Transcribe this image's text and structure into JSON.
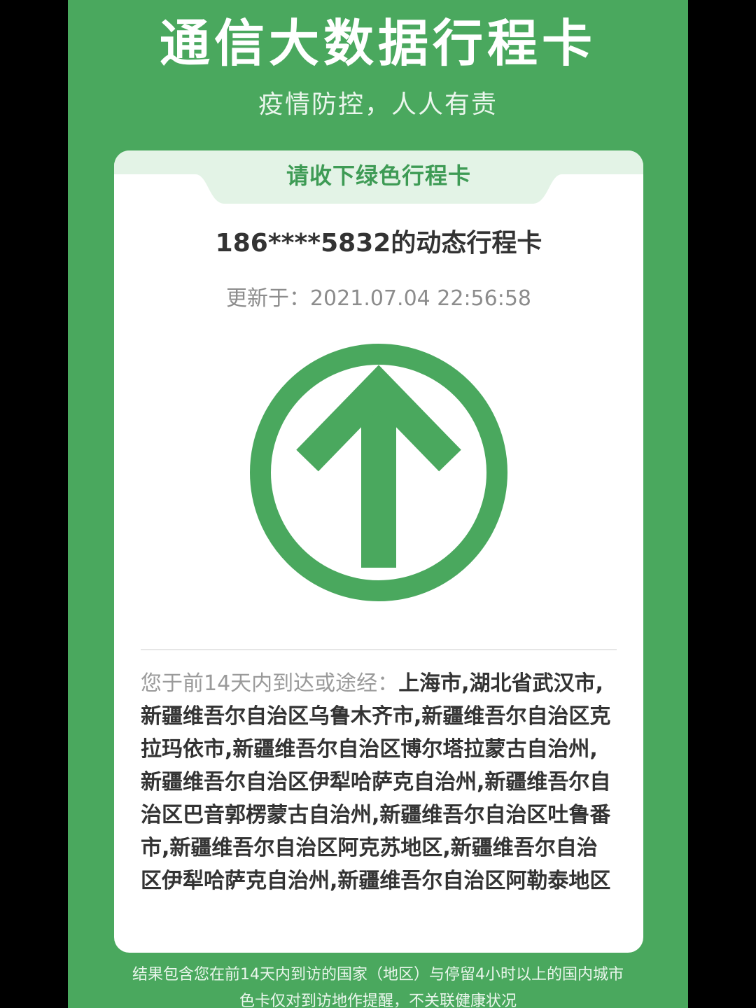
{
  "app": {
    "title": "通信大数据行程卡",
    "subtitle": "疫情防控，人人有责"
  },
  "card": {
    "header_label": "请收下绿色行程卡",
    "title": "186****5832的动态行程卡",
    "updated_label": "更新于：",
    "updated_time": "2021.07.04 22:56:58",
    "status_icon": "up-arrow-circle-icon",
    "status_color": "#4aa85e",
    "trip_label": "您于前14天内到达或途经：",
    "trip_places": "上海市,湖北省武汉市,新疆维吾尔自治区乌鲁木齐市,新疆维吾尔自治区克拉玛依市,新疆维吾尔自治区博尔塔拉蒙古自治州,新疆维吾尔自治区伊犁哈萨克自治州,新疆维吾尔自治区巴音郭楞蒙古自治州,新疆维吾尔自治区吐鲁番市,新疆维吾尔自治区阿克苏地区,新疆维吾尔自治区伊犁哈萨克自治州,新疆维吾尔自治区阿勒泰地区"
  },
  "footer": {
    "note_line1": "结果包含您在前14天内到访的国家（地区）与停留4小时以上的国内城市",
    "note_line2": "色卡仅对到访地作提醒，不关联健康状况"
  },
  "colors": {
    "background": "#4aa85e",
    "card": "#ffffff",
    "header_tab": "#e3f3e6",
    "accent_text": "#3e9b55"
  }
}
